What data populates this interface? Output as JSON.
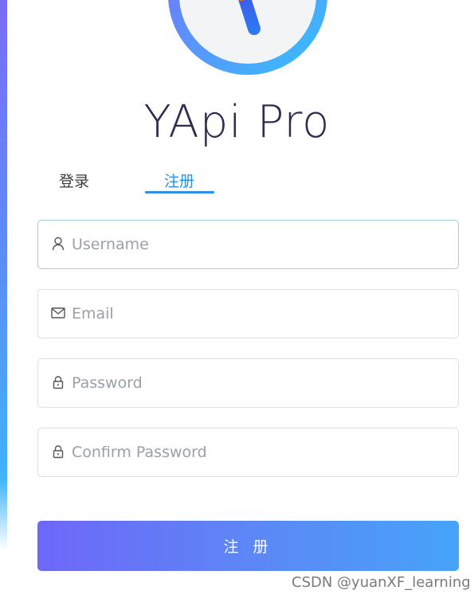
{
  "app": {
    "title": "YApi Pro"
  },
  "tabs": [
    {
      "label": "登录",
      "active": false
    },
    {
      "label": "注册",
      "active": true
    }
  ],
  "form": {
    "username": {
      "placeholder": "Username",
      "value": ""
    },
    "email": {
      "placeholder": "Email",
      "value": ""
    },
    "password": {
      "placeholder": "Password",
      "value": ""
    },
    "confirm": {
      "placeholder": "Confirm Password",
      "value": ""
    },
    "submit_label": "注 册"
  },
  "watermark": "CSDN @yuanXF_learning",
  "icons": {
    "username": "user-icon",
    "email": "mail-icon",
    "password": "lock-icon",
    "confirm": "lock-icon"
  },
  "colors": {
    "accent": "#2f8fe6",
    "title": "#2d2c52",
    "button_start": "#6e67f8",
    "button_end": "#46a3f8"
  }
}
